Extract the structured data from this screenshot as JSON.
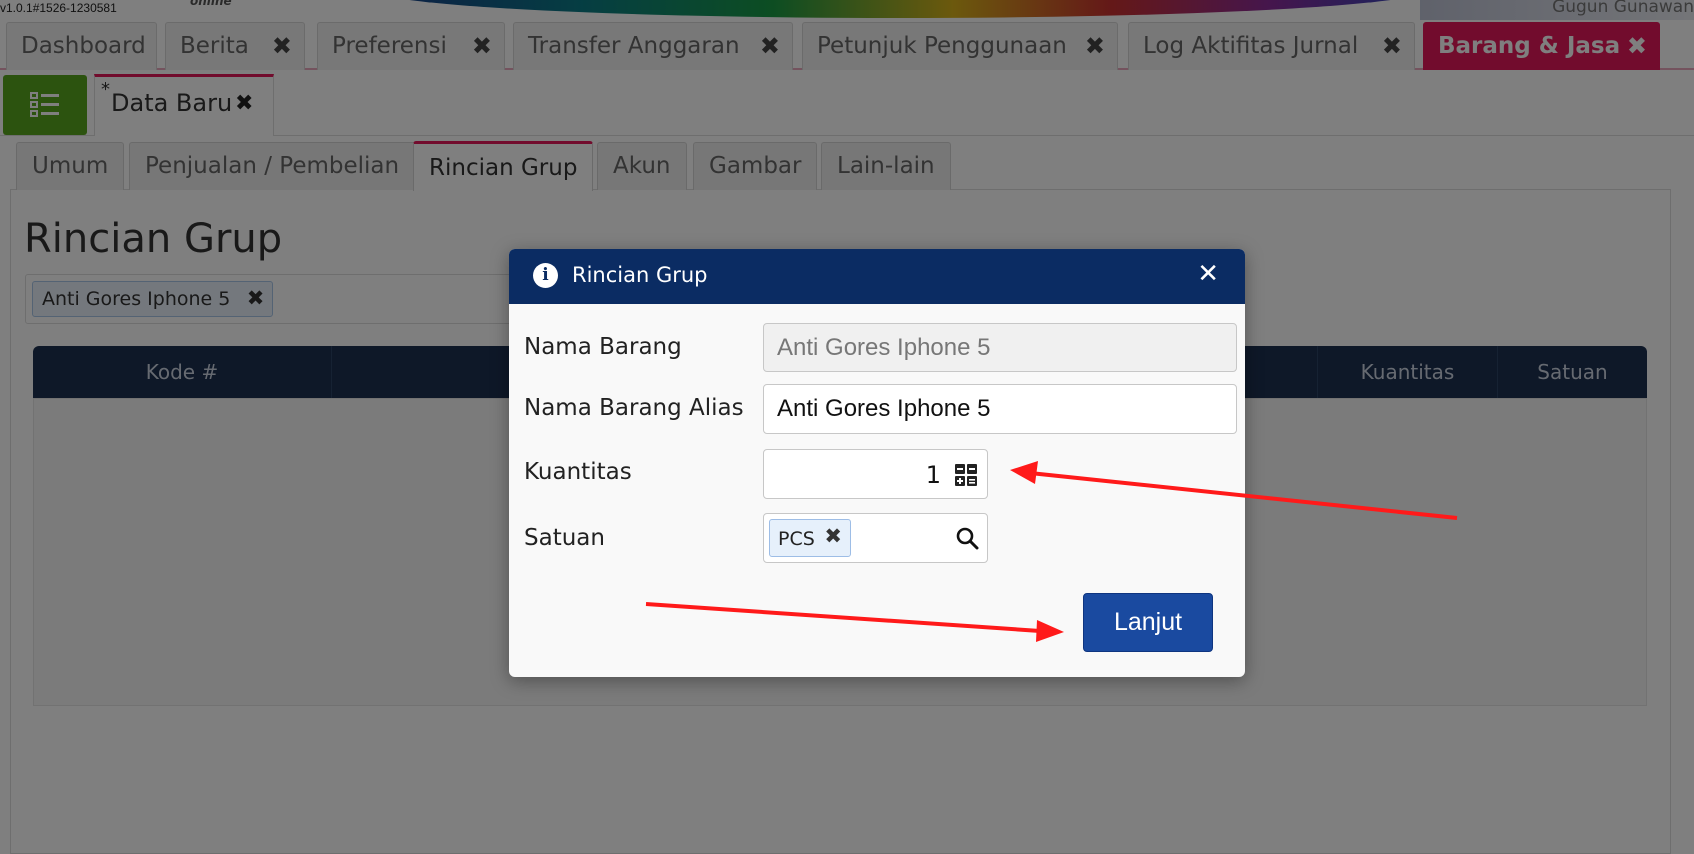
{
  "header": {
    "version": "v1.0.1#1526-1230581",
    "online_label": "online",
    "user_name": "Gugun Gunawan"
  },
  "main_tabs": [
    {
      "label": "Dashboard",
      "closable": false,
      "active": false
    },
    {
      "label": "Berita",
      "closable": true,
      "active": false
    },
    {
      "label": "Preferensi",
      "closable": true,
      "active": false
    },
    {
      "label": "Transfer Anggaran",
      "closable": true,
      "active": false
    },
    {
      "label": "Petunjuk Penggunaan",
      "closable": true,
      "active": false
    },
    {
      "label": "Log Aktifitas Jurnal",
      "closable": true,
      "active": false
    },
    {
      "label": "Barang & Jasa",
      "closable": true,
      "active": true
    }
  ],
  "close_glyph": "✖",
  "sub_tab": {
    "modified_mark": "*",
    "label": "Data Baru"
  },
  "form_tabs": [
    {
      "label": "Umum",
      "active": false
    },
    {
      "label": "Penjualan / Pembelian",
      "active": false
    },
    {
      "label": "Rincian Grup",
      "active": true
    },
    {
      "label": "Akun",
      "active": false
    },
    {
      "label": "Gambar",
      "active": false
    },
    {
      "label": "Lain-lain",
      "active": false
    }
  ],
  "page": {
    "title": "Rincian Grup",
    "selected_tag": "Anti Gores Iphone 5"
  },
  "table": {
    "columns": [
      "Kode #",
      "",
      "Kuantitas",
      "Satuan"
    ],
    "rows": []
  },
  "modal": {
    "title": "Rincian Grup",
    "info_glyph": "i",
    "close_glyph": "✕",
    "fields": {
      "nama_barang": {
        "label": "Nama Barang",
        "value": "Anti Gores Iphone 5"
      },
      "nama_barang_alias": {
        "label": "Nama Barang Alias",
        "value": "Anti Gores Iphone 5"
      },
      "kuantitas": {
        "label": "Kuantitas",
        "value": "1"
      },
      "satuan": {
        "label": "Satuan",
        "value": "PCS"
      }
    },
    "submit_label": "Lanjut"
  },
  "colors": {
    "active_tab": "#e5185a",
    "modal_header": "#0b2c63",
    "primary_button": "#1a4aa0",
    "menu_button": "#59a71f",
    "annotation_arrow": "#ff0000"
  },
  "icons": [
    "list-icon",
    "info-icon",
    "close-icon",
    "calculator-icon",
    "search-icon"
  ]
}
